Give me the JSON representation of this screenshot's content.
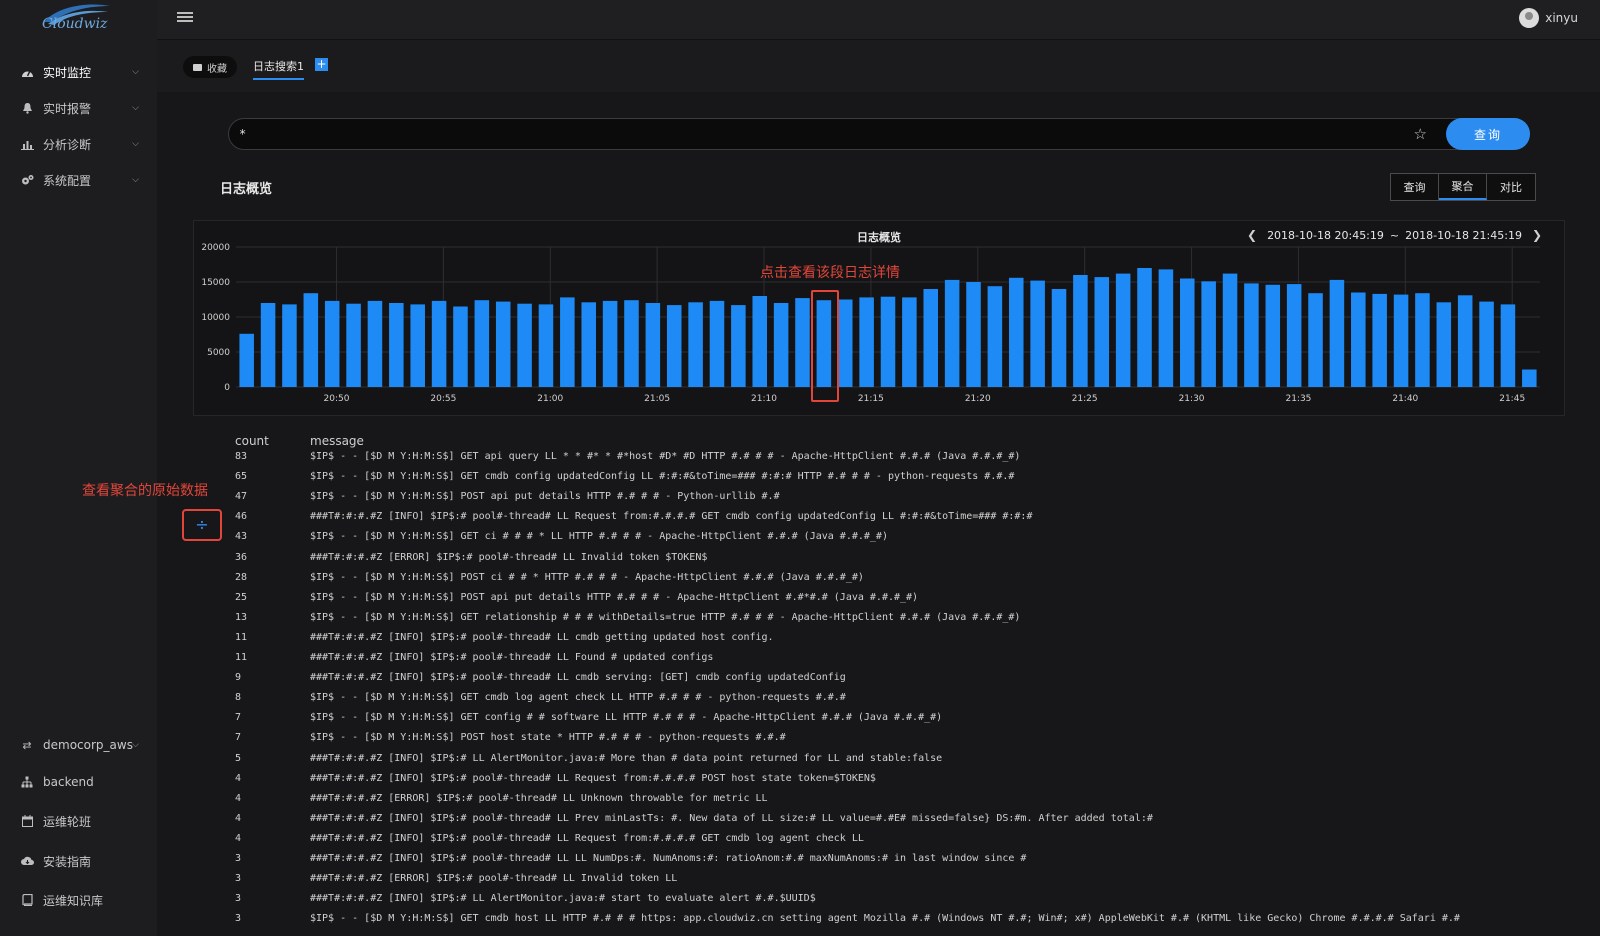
{
  "brand": {
    "logo_text": "Cloudwiz"
  },
  "user": {
    "name": "xinyu"
  },
  "sidebar": {
    "items": [
      {
        "label": "实时监控",
        "icon": "dashboard-icon",
        "chevron": true
      },
      {
        "label": "实时报警",
        "icon": "bell-icon",
        "chevron": true
      },
      {
        "label": "分析诊断",
        "icon": "bar-chart-icon",
        "chevron": true
      },
      {
        "label": "系统配置",
        "icon": "gear-icon",
        "chevron": true
      }
    ],
    "bottom": [
      {
        "label": "democorp_aws",
        "icon": "shuffle-icon",
        "chevron": true
      },
      {
        "label": "backend",
        "icon": "sitemap-icon",
        "chevron": false
      },
      {
        "label": "运维轮班",
        "icon": "calendar-icon",
        "chevron": false
      },
      {
        "label": "安装指南",
        "icon": "cloud-download-icon",
        "chevron": false
      },
      {
        "label": "运维知识库",
        "icon": "book-icon",
        "chevron": false
      }
    ]
  },
  "tabs": {
    "favorites_label": "收藏",
    "active_tab": "日志搜索1",
    "add_label": "+"
  },
  "search": {
    "value": "*",
    "button_label": "查询"
  },
  "overview": {
    "title": "日志概览",
    "modes": [
      "查询",
      "聚合",
      "对比"
    ],
    "active_mode": "聚合"
  },
  "chart_header": {
    "title": "日志概览",
    "range_start": "2018-10-18 20:45:19",
    "range_sep": "~",
    "range_end": "2018-10-18 21:45:19"
  },
  "annotations": {
    "chart_click": "点击查看该段日志详情",
    "raw_data": "查看聚合的原始数据"
  },
  "chart_data": {
    "type": "bar",
    "title": "日志概览",
    "ylim": [
      0,
      20000
    ],
    "yticks": [
      0,
      5000,
      10000,
      15000,
      20000
    ],
    "xtick_labels": [
      "20:50",
      "20:55",
      "21:00",
      "21:05",
      "21:10",
      "21:15",
      "21:20",
      "21:25",
      "21:30",
      "21:35",
      "21:40",
      "21:45"
    ],
    "bar_color": "#1e8af5",
    "highlight_index": 27,
    "values": [
      7600,
      12000,
      11800,
      13400,
      12300,
      11900,
      12300,
      12000,
      11800,
      12300,
      11500,
      12400,
      12200,
      11900,
      11800,
      12800,
      12100,
      12300,
      12400,
      12000,
      11700,
      12100,
      12300,
      11700,
      13000,
      12000,
      12700,
      12400,
      12500,
      12800,
      12900,
      12800,
      14000,
      15300,
      15000,
      14400,
      15600,
      15200,
      14000,
      16000,
      15700,
      16200,
      17000,
      16800,
      15500,
      15100,
      16200,
      14800,
      14600,
      14700,
      13400,
      15300,
      13500,
      13300,
      13200,
      13400,
      12100,
      13100,
      12200,
      11800,
      2500
    ]
  },
  "table": {
    "headers": {
      "count": "count",
      "message": "message"
    },
    "rows": [
      {
        "count": "83",
        "message": "$IP$ - - [$D M Y:H:M:S$] GET api query LL * * #* * #*host #D* #D HTTP #.# # # - Apache-HttpClient #.#.# (Java #.#.#_#)"
      },
      {
        "count": "65",
        "message": "$IP$ - - [$D M Y:H:M:S$] GET cmdb config updatedConfig LL #:#:#&toTime=### #:#:# HTTP #.# # # - python-requests #.#.#"
      },
      {
        "count": "47",
        "message": "$IP$ - - [$D M Y:H:M:S$] POST api put details HTTP #.# # # - Python-urllib #.#"
      },
      {
        "count": "46",
        "message": "###T#:#:#.#Z [INFO] $IP$:# pool#-thread# LL Request from:#.#.#.# GET cmdb config updatedConfig LL #:#:#&toTime=### #:#:#"
      },
      {
        "count": "43",
        "message": "$IP$ - - [$D M Y:H:M:S$] GET ci # # # * LL HTTP #.# # # - Apache-HttpClient #.#.# (Java #.#.#_#)"
      },
      {
        "count": "36",
        "message": "###T#:#:#.#Z [ERROR] $IP$:# pool#-thread# LL Invalid token $TOKEN$"
      },
      {
        "count": "28",
        "message": "$IP$ - - [$D M Y:H:M:S$] POST ci # # * HTTP #.# # # - Apache-HttpClient #.#.# (Java #.#.#_#)"
      },
      {
        "count": "25",
        "message": "$IP$ - - [$D M Y:H:M:S$] POST api put details HTTP #.# # # - Apache-HttpClient #.#*#.# (Java #.#.#_#)"
      },
      {
        "count": "13",
        "message": "$IP$ - - [$D M Y:H:M:S$] GET relationship # # # withDetails=true HTTP #.# # # - Apache-HttpClient #.#.# (Java #.#.#_#)"
      },
      {
        "count": "11",
        "message": "###T#:#:#.#Z [INFO] $IP$:# pool#-thread# LL cmdb getting updated host config."
      },
      {
        "count": "11",
        "message": "###T#:#:#.#Z [INFO] $IP$:# pool#-thread# LL Found # updated configs"
      },
      {
        "count": "9",
        "message": "###T#:#:#.#Z [INFO] $IP$:# pool#-thread# LL cmdb serving: [GET] cmdb config updatedConfig"
      },
      {
        "count": "8",
        "message": "$IP$ - - [$D M Y:H:M:S$] GET cmdb log agent check LL HTTP #.# # # - python-requests #.#.#"
      },
      {
        "count": "7",
        "message": "$IP$ - - [$D M Y:H:M:S$] GET config # # software LL HTTP #.# # # - Apache-HttpClient #.#.# (Java #.#.#_#)"
      },
      {
        "count": "7",
        "message": "$IP$ - - [$D M Y:H:M:S$] POST host state * HTTP #.# # # - python-requests #.#.#"
      },
      {
        "count": "5",
        "message": "###T#:#:#.#Z [INFO] $IP$:# LL AlertMonitor.java:# More than # data point returned for LL and stable:false"
      },
      {
        "count": "4",
        "message": "###T#:#:#.#Z [INFO] $IP$:# pool#-thread# LL Request from:#.#.#.# POST host state token=$TOKEN$"
      },
      {
        "count": "4",
        "message": "###T#:#:#.#Z [ERROR] $IP$:# pool#-thread# LL Unknown throwable for metric LL"
      },
      {
        "count": "4",
        "message": "###T#:#:#.#Z [INFO] $IP$:# pool#-thread# LL Prev minLastTs: #. New data of LL size:# LL value=#.#E# missed=false} DS:#m. After added total:#"
      },
      {
        "count": "4",
        "message": "###T#:#:#.#Z [INFO] $IP$:# pool#-thread# LL Request from:#.#.#.# GET cmdb log agent check LL"
      },
      {
        "count": "3",
        "message": "###T#:#:#.#Z [INFO] $IP$:# pool#-thread# LL LL NumDps:#. NumAnoms:#: ratioAnom:#.# maxNumAnoms:# in last window since #"
      },
      {
        "count": "3",
        "message": "###T#:#:#.#Z [ERROR] $IP$:# pool#-thread# LL Invalid token LL"
      },
      {
        "count": "3",
        "message": "###T#:#:#.#Z [INFO] $IP$:# LL AlertMonitor.java:# start to evaluate alert #.#.$UUID$"
      },
      {
        "count": "3",
        "message": "$IP$ - - [$D M Y:H:M:S$] GET cmdb host LL HTTP #.# # # https: app.cloudwiz.cn setting agent Mozilla #.# (Windows NT #.#; Win#; x#) AppleWebKit #.# (KHTML like Gecko) Chrome #.#.#.# Safari #.#"
      }
    ]
  }
}
